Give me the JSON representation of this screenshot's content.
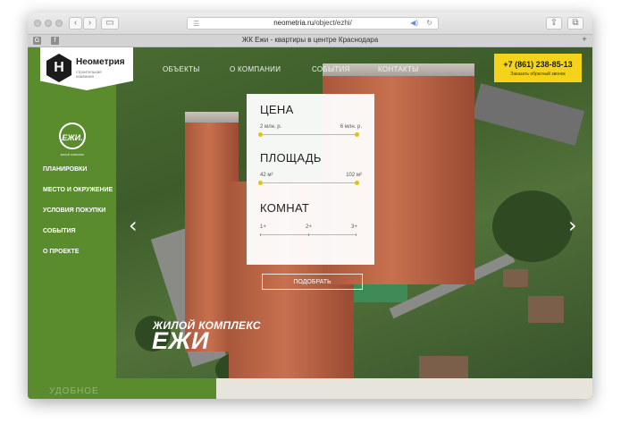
{
  "browser": {
    "url_host": "neometria.ru",
    "url_path": "/object/ezhi/",
    "tab_title": "ЖК Ежи - квартиры в центре Краснодара",
    "tab_icons": [
      "G",
      "f"
    ]
  },
  "brand": {
    "logo_letter": "H",
    "name": "Неометрия",
    "subtitle": "строительная компания"
  },
  "top_nav": {
    "items": [
      {
        "label": "ОБЪЕКТЫ"
      },
      {
        "label": "О КОМПАНИИ"
      },
      {
        "label": "СОБЫТИЯ"
      },
      {
        "label": "КОНТАКТЫ"
      }
    ]
  },
  "callback": {
    "phone": "+7 (861) 238-85-13",
    "label": "Заказать обратный звонок"
  },
  "project_badge": {
    "name": "ЕЖИ.",
    "subtitle": "жилой комплекс"
  },
  "sidebar": {
    "items": [
      {
        "label": "ПЛАНИРОВКИ"
      },
      {
        "label": "МЕСТО И ОКРУЖЕНИЕ"
      },
      {
        "label": "УСЛОВИЯ ПОКУПКИ"
      },
      {
        "label": "СОБЫТИЯ"
      },
      {
        "label": "О ПРОЕКТЕ"
      }
    ]
  },
  "filter": {
    "price": {
      "title": "ЦЕНА",
      "min_label": "2 млн. р.",
      "max_label": "6 млн. р."
    },
    "area": {
      "title": "ПЛОЩАДЬ",
      "min_label": "42 м²",
      "max_label": "102 м²"
    },
    "rooms": {
      "title": "КОМНАТ",
      "options": [
        "1+",
        "2+",
        "3+"
      ]
    },
    "submit": "ПОДОБРАТЬ"
  },
  "hero": {
    "line1": "ЖИЛОЙ КОМПЛЕКС",
    "line2": "ЕЖИ"
  },
  "bottom": {
    "word": "УДОБНОЕ"
  },
  "colors": {
    "sidebar_green": "#5a8b2d",
    "accent_yellow": "#f5d31a"
  }
}
